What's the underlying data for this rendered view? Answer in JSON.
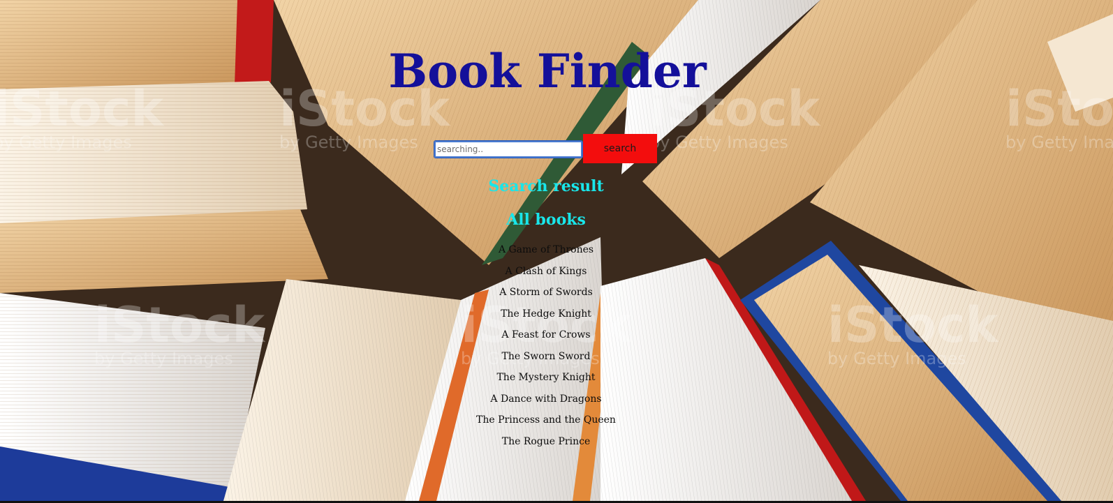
{
  "header": {
    "title": "Book Finder"
  },
  "search": {
    "placeholder": "searching..",
    "value": "",
    "button_label": "search"
  },
  "sections": {
    "search_result_heading": "Search result",
    "all_books_heading": "All books"
  },
  "books": [
    "A Game of Thrones",
    "A Clash of Kings",
    "A Storm of Swords",
    "The Hedge Knight",
    "A Feast for Crows",
    "The Sworn Sword",
    "The Mystery Knight",
    "A Dance with Dragons",
    "The Princess and the Queen",
    "The Rogue Prince"
  ],
  "background": {
    "watermark_text": "iStock",
    "watermark_subtext": "by Getty Images"
  },
  "colors": {
    "title": "#14109a",
    "section_heading": "#19e6ea",
    "search_button": "#f30d0d",
    "book_text": "#0c0c0c"
  }
}
